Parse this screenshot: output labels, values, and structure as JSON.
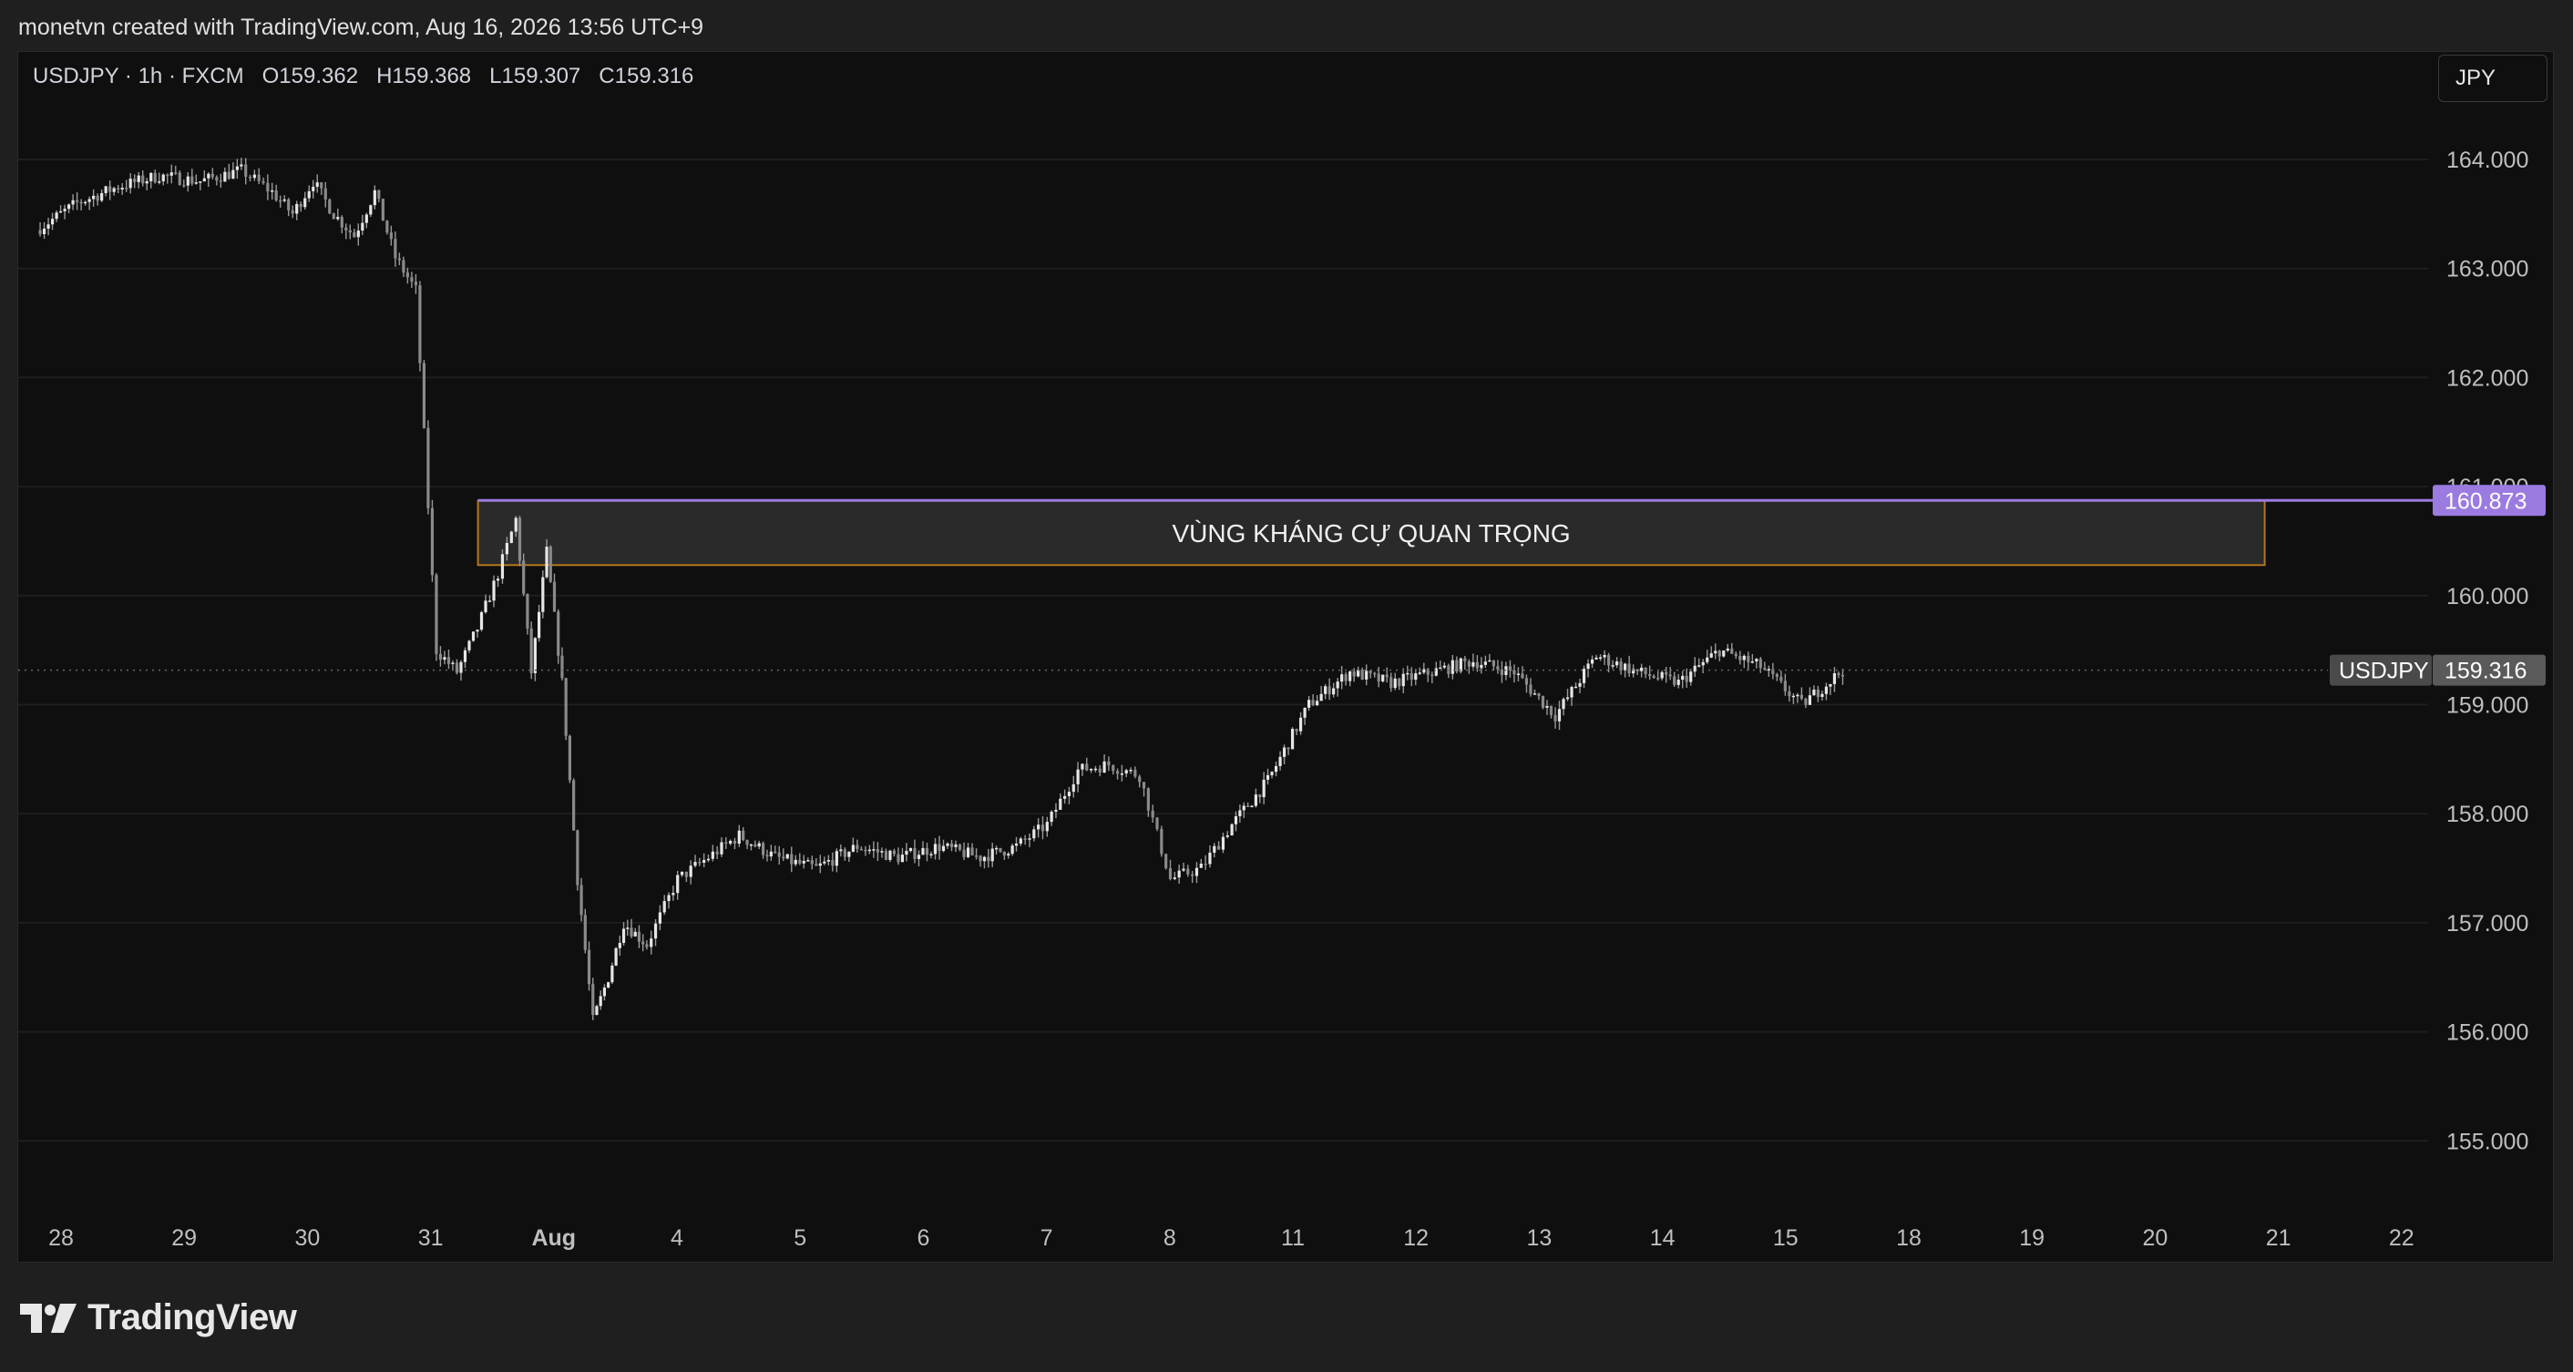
{
  "header": {
    "attribution": "monetvn created with TradingView.com, Aug 16, 2026 13:56 UTC+9"
  },
  "legend": {
    "symbol": "USDJPY · 1h · FXCM",
    "open": "O159.362",
    "high": "H159.368",
    "low": "L159.307",
    "close": "C159.316"
  },
  "currency_button": "JPY",
  "brand": {
    "name": "TradingView"
  },
  "colors": {
    "background": "#0f0f0f",
    "candle": "#c8c8c8",
    "resistance_line": "#9b7be0",
    "zone_border": "#b5761c",
    "zone_fill": "#2a2a2a"
  },
  "chart_data": {
    "type": "candlestick",
    "symbol": "USDJPY",
    "interval": "1h",
    "ylim": [
      154.0,
      165.0
    ],
    "y_ticks": [
      "164.000",
      "163.000",
      "162.000",
      "161.000",
      "160.000",
      "159.000",
      "158.000",
      "157.000",
      "156.000",
      "155.000"
    ],
    "x_ticks": [
      "28",
      "29",
      "30",
      "31",
      "Aug",
      "4",
      "5",
      "6",
      "7",
      "8",
      "11",
      "12",
      "13",
      "14",
      "15",
      "18",
      "19",
      "20",
      "21",
      "22"
    ],
    "last_price": {
      "label": "USDJPY",
      "value": "159.316",
      "price": 159.316
    },
    "resistance_line": {
      "value": "160.873",
      "price": 160.873
    },
    "zone": {
      "label": "VÙNG KHÁNG CỰ QUAN TRỌNG",
      "top": 160.87,
      "bottom": 160.28,
      "from_tick": "31",
      "to_tick": "21"
    },
    "close_path": [
      [
        "28",
        163.35
      ],
      [
        "28",
        163.6
      ],
      [
        "28",
        163.75
      ],
      [
        "29",
        163.85
      ],
      [
        "29",
        163.8
      ],
      [
        "29",
        163.9
      ],
      [
        "30",
        163.7
      ],
      [
        "30",
        163.5
      ],
      [
        "30",
        163.8
      ],
      [
        "30",
        163.5
      ],
      [
        "30",
        163.3
      ],
      [
        "30",
        163.7
      ],
      [
        "31",
        163.1
      ],
      [
        "31",
        162.8
      ],
      [
        "31",
        159.5
      ],
      [
        "31",
        159.3
      ],
      [
        "31",
        159.7
      ],
      [
        "31",
        160.2
      ],
      [
        "Aug",
        160.7
      ],
      [
        "Aug",
        159.3
      ],
      [
        "Aug",
        160.4
      ],
      [
        "Aug",
        159.2
      ],
      [
        "Aug",
        157.4
      ],
      [
        "Aug",
        156.1
      ],
      [
        "Aug",
        156.5
      ],
      [
        "Aug",
        157.0
      ],
      [
        "4",
        156.8
      ],
      [
        "4",
        157.4
      ],
      [
        "4",
        157.6
      ],
      [
        "4",
        157.8
      ],
      [
        "5",
        157.6
      ],
      [
        "5",
        157.5
      ],
      [
        "5",
        157.7
      ],
      [
        "6",
        157.6
      ],
      [
        "6",
        157.7
      ],
      [
        "6",
        157.6
      ],
      [
        "7",
        157.7
      ],
      [
        "7",
        157.9
      ],
      [
        "7",
        158.4
      ],
      [
        "7",
        158.45
      ],
      [
        "8",
        158.35
      ],
      [
        "8",
        157.4
      ],
      [
        "8",
        157.5
      ],
      [
        "8",
        157.9
      ],
      [
        "11",
        158.3
      ],
      [
        "11",
        159.0
      ],
      [
        "11",
        159.3
      ],
      [
        "12",
        159.2
      ],
      [
        "12",
        159.3
      ],
      [
        "12",
        159.4
      ],
      [
        "13",
        159.3
      ],
      [
        "13",
        158.9
      ],
      [
        "13",
        159.45
      ],
      [
        "14",
        159.3
      ],
      [
        "14",
        159.2
      ],
      [
        "14",
        159.5
      ],
      [
        "15",
        159.35
      ],
      [
        "15",
        159.0
      ],
      [
        "15",
        159.316
      ]
    ]
  }
}
